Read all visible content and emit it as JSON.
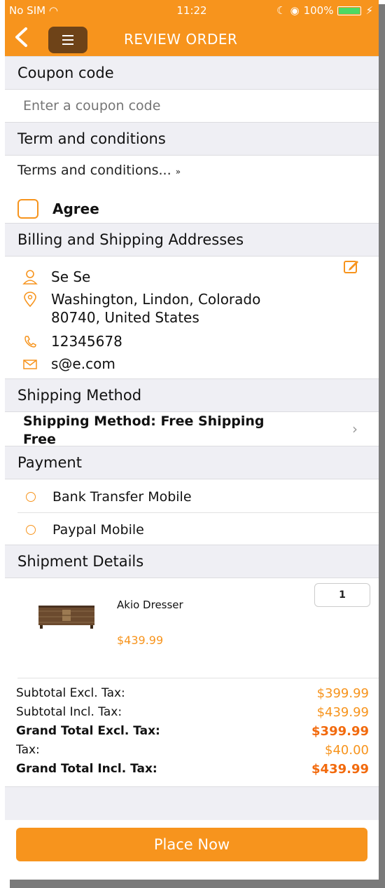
{
  "status_bar": {
    "carrier": "No SIM",
    "time": "11:22",
    "battery": "100%"
  },
  "header": {
    "title": "REVIEW ORDER"
  },
  "coupon": {
    "section_title": "Coupon code",
    "placeholder": "Enter a coupon code"
  },
  "terms": {
    "section_title": "Term and conditions",
    "link_text": "Terms and conditions...",
    "link_suffix": "»",
    "agree_label": "Agree"
  },
  "address": {
    "section_title": "Billing and Shipping Addresses",
    "name": "Se Se",
    "location_line1": "Washington, Lindon, Colorado",
    "location_line2": "80740, United States",
    "phone": "12345678",
    "email": "s@e.com"
  },
  "shipping": {
    "section_title": "Shipping Method",
    "method_line1": "Shipping Method: Free Shipping",
    "method_line2": "Free"
  },
  "payment": {
    "section_title": "Payment",
    "options": [
      {
        "label": "Bank Transfer Mobile"
      },
      {
        "label": "Paypal Mobile"
      }
    ]
  },
  "shipment": {
    "section_title": "Shipment Details",
    "product_name": "Akio Dresser",
    "product_price": "$439.99",
    "quantity": "1"
  },
  "totals": [
    {
      "label": "Subtotal Excl. Tax:",
      "amount": "$399.99",
      "bold": false
    },
    {
      "label": "Subtotal Incl. Tax:",
      "amount": "$439.99",
      "bold": false
    },
    {
      "label": "Grand Total Excl. Tax:",
      "amount": "$399.99",
      "bold": true
    },
    {
      "label": "Tax:",
      "amount": "$40.00",
      "bold": false
    },
    {
      "label": "Grand Total Incl. Tax:",
      "amount": "$439.99",
      "bold": true
    }
  ],
  "footer": {
    "place_button": "Place Now"
  },
  "colors": {
    "accent": "#f7941d",
    "menu_button": "#6e4318",
    "section_bg": "#efeff4",
    "price": "#f7941d"
  }
}
